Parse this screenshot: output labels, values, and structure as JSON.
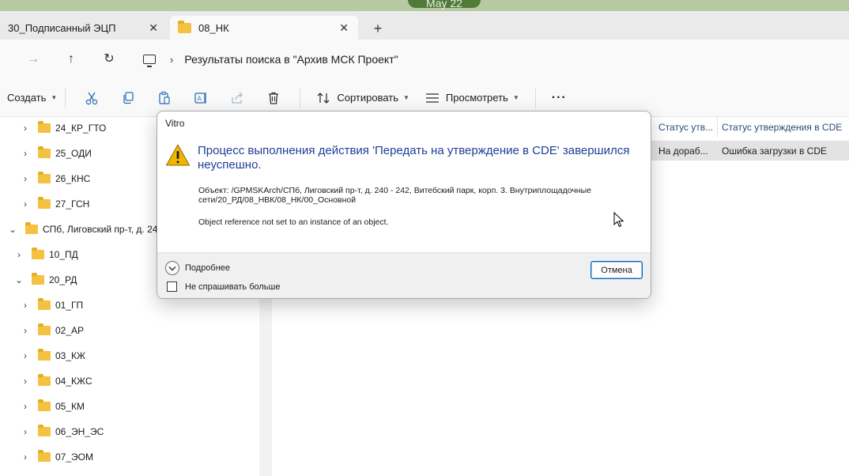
{
  "wallpaper": {
    "date_fragment": "May 22"
  },
  "tabs": [
    {
      "label": "30_Подписанный ЭЦП",
      "active": false
    },
    {
      "label": "08_НК",
      "active": true
    }
  ],
  "address": {
    "path": "Результаты поиска в \"Архив МСК Проект\""
  },
  "toolbar": {
    "create_label": "Создать",
    "sort_label": "Сортировать",
    "view_label": "Просмотреть",
    "more_label": "···"
  },
  "nav": {
    "items": [
      {
        "label": "24_КР_ГТО"
      },
      {
        "label": "25_ОДИ"
      },
      {
        "label": "26_КНС"
      },
      {
        "label": "27_ГСН"
      },
      {
        "label": "СПб, Лиговский пр-т, д. 24"
      },
      {
        "label": "10_ПД"
      },
      {
        "label": "20_РД"
      },
      {
        "label": "01_ГП"
      },
      {
        "label": "02_АР"
      },
      {
        "label": "03_КЖ"
      },
      {
        "label": "04_КЖС"
      },
      {
        "label": "05_КМ"
      },
      {
        "label": "06_ЭН_ЭС"
      },
      {
        "label": "07_ЭОМ"
      }
    ]
  },
  "content": {
    "columns": [
      "Статус утв...",
      "Статус утверждения в CDE"
    ],
    "row": {
      "status": "На дораб...",
      "cde_status": "Ошибка загрузки в CDE"
    }
  },
  "dialog": {
    "title": "Vitro",
    "main_message": "Процесс выполнения действия 'Передать на утверждение в CDE' завершился неуспешно.",
    "object_detail": "Объект: /GPMSKArch/СПб, Лиговский пр-т, д. 240 - 242, Витебский парк, корп. 3. Внутриплощадочные сети/20_РД/08_НВК/08_НК/00_Основной",
    "error_text": "Object reference not set to an instance of an object.",
    "expander_label": "Подробнее",
    "checkbox_label": "Не спрашивать больше",
    "cancel_label": "Отмена"
  },
  "colors": {
    "accent": "#0067c0",
    "dialog_heading": "#1e3e96",
    "folder": "#f4c141",
    "warning": "#f2b600"
  }
}
